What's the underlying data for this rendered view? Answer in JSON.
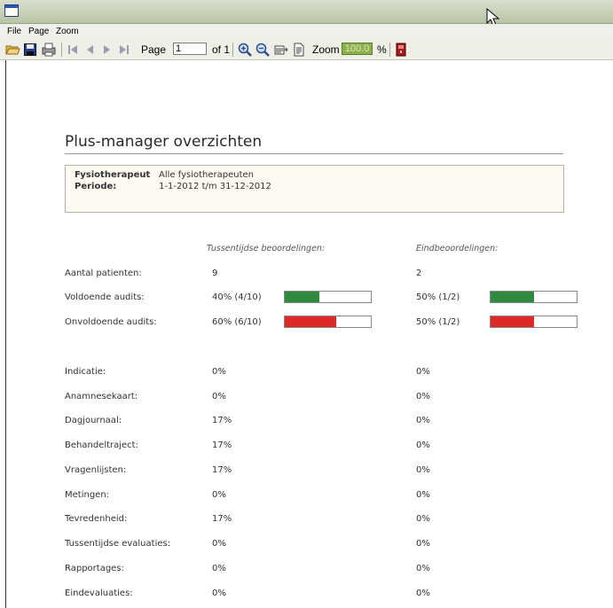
{
  "menu": {
    "items": [
      "File",
      "Page",
      "Zoom"
    ]
  },
  "toolbar": {
    "page_label": "Page",
    "page_value": "1",
    "of_label": "of 1",
    "zoom_label": "Zoom",
    "zoom_value": "100.0",
    "percent_label": "%"
  },
  "report": {
    "title": "Plus-manager overzichten",
    "info": {
      "fysiotherapeut_label": "Fysiotherapeut",
      "fysiotherapeut_value": "Alle fysiotherapeuten",
      "periode_label": "Periode:",
      "periode_value": "1-1-2012 t/m 31-12-2012"
    },
    "columns": {
      "tussentijds": "Tussentijdse beoordelingen:",
      "eind": "Eindbeoordelingen:"
    },
    "summary_rows": [
      {
        "label": "Aantal patienten:",
        "tussentijds": "9",
        "eind": "2"
      },
      {
        "label": "Voldoende audits:",
        "tussentijds": "40% (4/10)",
        "eind": "50% (1/2)",
        "tussentijds_fraction": 0.4,
        "eind_fraction": 0.5,
        "color": "#2e8b3e"
      },
      {
        "label": "Onvoldoende audits:",
        "tussentijds": "60% (6/10)",
        "eind": "50% (1/2)",
        "tussentijds_fraction": 0.6,
        "eind_fraction": 0.5,
        "color": "#e02828"
      }
    ],
    "detail_rows": [
      {
        "label": "Indicatie:",
        "tussentijds": "0%",
        "eind": "0%"
      },
      {
        "label": "Anamnesekaart:",
        "tussentijds": "0%",
        "eind": "0%"
      },
      {
        "label": "Dagjournaal:",
        "tussentijds": "17%",
        "eind": "0%"
      },
      {
        "label": "Behandeltraject:",
        "tussentijds": "17%",
        "eind": "0%"
      },
      {
        "label": "Vragenlijsten:",
        "tussentijds": "17%",
        "eind": "0%"
      },
      {
        "label": "Metingen:",
        "tussentijds": "0%",
        "eind": "0%"
      },
      {
        "label": "Tevredenheid:",
        "tussentijds": "17%",
        "eind": "0%"
      },
      {
        "label": "Tussentijdse evaluaties:",
        "tussentijds": "0%",
        "eind": "0%"
      },
      {
        "label": "Rapportages:",
        "tussentijds": "0%",
        "eind": "0%"
      },
      {
        "label": "Eindevaluaties:",
        "tussentijds": "0%",
        "eind": "0%"
      }
    ]
  },
  "icons": [
    "window-icon",
    "open-folder-icon",
    "save-icon",
    "print-icon",
    "first-page-icon",
    "previous-page-icon",
    "next-page-icon",
    "last-page-icon",
    "zoom-in-icon",
    "zoom-out-icon",
    "page-width-icon",
    "whole-page-icon",
    "close-report-icon",
    "mouse-cursor-icon"
  ]
}
